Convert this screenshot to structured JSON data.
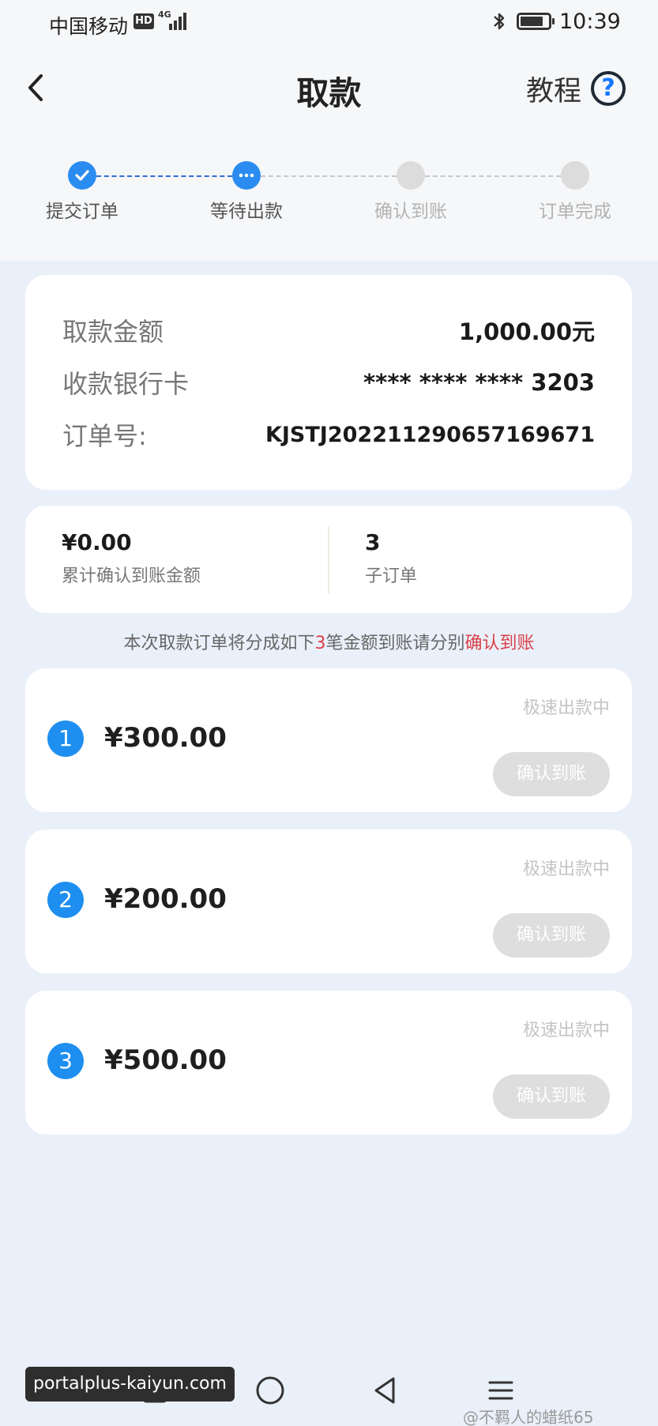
{
  "status_bar": {
    "carrier": "中国移动",
    "hd_badge": "HD",
    "network": "4G",
    "time": "10:39"
  },
  "header": {
    "title": "取款",
    "tutorial_label": "教程",
    "help_icon": "?"
  },
  "stepper": {
    "steps": [
      {
        "label": "提交订单",
        "state": "done"
      },
      {
        "label": "等待出款",
        "state": "in_progress"
      },
      {
        "label": "确认到账",
        "state": "pending"
      },
      {
        "label": "订单完成",
        "state": "pending"
      }
    ]
  },
  "order_info": {
    "amount_label": "取款金额",
    "amount_value": "1,000.00元",
    "bank_label": "收款银行卡",
    "bank_value": "**** **** **** 3203",
    "order_no_label": "订单号:",
    "order_no_value": "KJSTJ2022112906571696​71"
  },
  "stats": {
    "confirmed_value": "¥0.00",
    "confirmed_label": "累计确认到账金额",
    "suborders_value": "3",
    "suborders_label": "子订单"
  },
  "notice": {
    "prefix": "本次取款订单将分成如下",
    "count": "3",
    "middle": "笔金额到账请分别",
    "link": "确认到账"
  },
  "sub_orders": [
    {
      "index": "1",
      "amount": "¥300.00",
      "status": "极速出款中",
      "button": "确认到账"
    },
    {
      "index": "2",
      "amount": "¥200.00",
      "status": "极速出款中",
      "button": "确认到账"
    },
    {
      "index": "3",
      "amount": "¥500.00",
      "status": "极速出款中",
      "button": "确认到账"
    }
  ],
  "overlay": {
    "url_tag": "portalplus-kaiyun.com",
    "attribution": "@不羁人的蜡纸65"
  },
  "colors": {
    "accent": "#1e8ff0",
    "highlight": "#d9404a",
    "background": "#eaf0f9"
  }
}
